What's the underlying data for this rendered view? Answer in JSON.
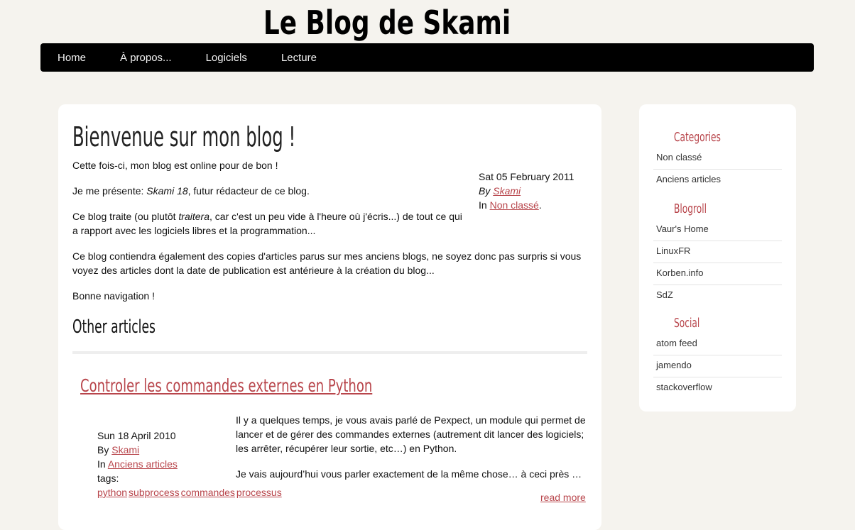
{
  "site": {
    "title": "Le Blog de Skami"
  },
  "nav": {
    "items": [
      "Home",
      "À propos...",
      "Logiciels",
      "Lecture"
    ]
  },
  "post": {
    "title": "Bienvenue sur mon blog !",
    "p1": "Cette fois-ci, mon blog est online pour de bon !",
    "p2_pre": "Je me présente: ",
    "p2_em": "Skami 18",
    "p2_post": ", futur rédacteur de ce blog.",
    "p3_pre": "Ce blog traite (ou plutôt ",
    "p3_em": "traitera",
    "p3_post": ", car c'est un peu vide à l'heure où j'écris...) de tout ce qui a rapport avec les logiciels libres et la programmation...",
    "p4": "Ce blog contiendra également des copies d'articles parus sur mes anciens blogs, ne soyez donc pas surpris si vous voyez des articles dont la date de publication est antérieure à la création du blog...",
    "p5": "Bonne navigation !",
    "date": "Sat 05 February 2011",
    "by_label": "By",
    "author": "Skami",
    "in_label": "In",
    "category": "Non classé",
    "category_suffix": "."
  },
  "other": {
    "heading": "Other articles",
    "article": {
      "title": "Controler les commandes externes en Python",
      "date": "Sun 18 April 2010",
      "by_label": "By",
      "author": "Skami",
      "in_label": "In",
      "category": "Anciens articles",
      "tags_label": "tags:",
      "tags": [
        "python",
        "subprocess",
        "commandes",
        "processus"
      ],
      "excerpt1": "Il y a quelques temps, je vous avais parlé de Pexpect, un module qui permet de lancer et de gérer des commandes externes (autrement dit lancer des logiciels; les arrêter, récupérer leur sortie, etc…) en Python.",
      "excerpt2": "Je vais aujourd’hui vous parler exactement de la même chose… à ceci près …",
      "read_more": "read more"
    }
  },
  "sidebar": {
    "categories": {
      "heading": "Categories",
      "items": [
        "Non classé",
        "Anciens articles"
      ]
    },
    "blogroll": {
      "heading": "Blogroll",
      "items": [
        "Vaur's Home",
        "LinuxFR",
        "Korben.info",
        "SdZ"
      ]
    },
    "social": {
      "heading": "Social",
      "items": [
        "atom feed",
        "jamendo",
        "stackoverflow"
      ]
    }
  },
  "colors": {
    "accent": "#b8454b",
    "nav_bg": "#000000",
    "page_bg": "#f5f3ee"
  }
}
